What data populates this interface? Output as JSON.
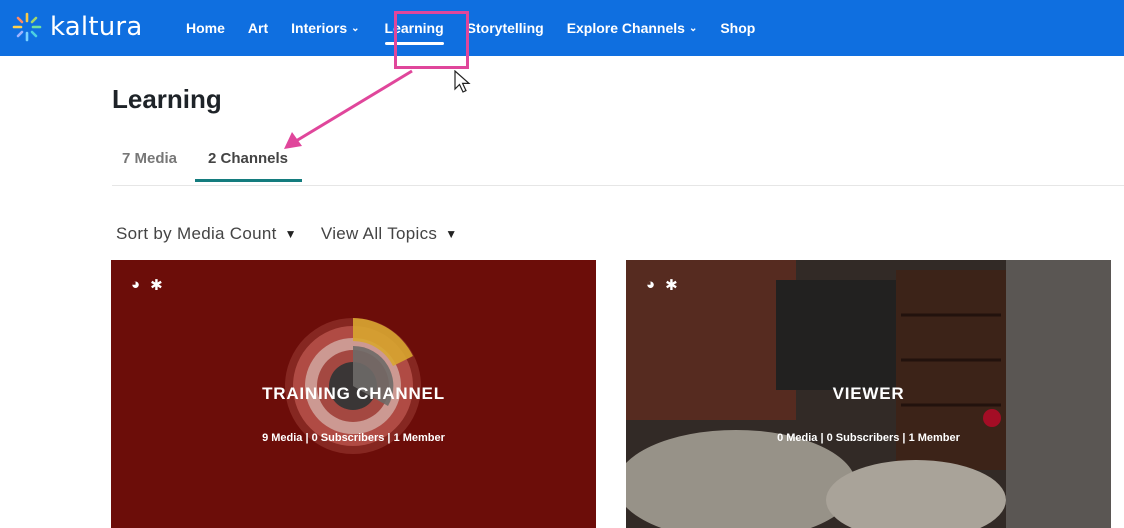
{
  "brand": {
    "name": "kaltura"
  },
  "nav": {
    "items": [
      {
        "label": "Home",
        "dropdown": false
      },
      {
        "label": "Art",
        "dropdown": false
      },
      {
        "label": "Interiors",
        "dropdown": true
      },
      {
        "label": "Learning",
        "dropdown": false,
        "active": true
      },
      {
        "label": "Storytelling",
        "dropdown": false
      },
      {
        "label": "Explore Channels",
        "dropdown": true
      },
      {
        "label": "Shop",
        "dropdown": false
      }
    ]
  },
  "page": {
    "title": "Learning"
  },
  "tabs": [
    {
      "label": "7 Media"
    },
    {
      "label": "2 Channels",
      "selected": true
    }
  ],
  "filters": {
    "sort_label": "Sort by Media Count",
    "topics_label": "View All Topics"
  },
  "channels": [
    {
      "title": "TRAINING CHANNEL",
      "meta": "9 Media |  0 Subscribers  |  1 Member"
    },
    {
      "title": "VIEWER",
      "meta": "0 Media |  0 Subscribers  |  1 Member"
    }
  ],
  "colors": {
    "topbar": "#0f6fe0",
    "annotation": "#e0469b",
    "tab_accent": "#147c7e"
  },
  "icons": {
    "card_public": "globe-icon",
    "card_featured": "asterisk-icon",
    "chevron": "chevron-down-icon"
  }
}
